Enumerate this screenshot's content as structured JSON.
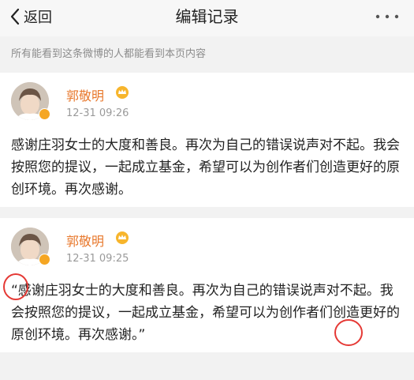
{
  "nav": {
    "back_label": "返回",
    "title": "编辑记录",
    "more_label": "···"
  },
  "notice": "所有能看到这条微博的人都能看到本页内容",
  "records": [
    {
      "user": "郭敬明",
      "time": "12-31 09:26",
      "content": "感谢庄羽女士的大度和善良。再次为自己的错误说声对不起。我会按照您的提议，一起成立基金，希望可以为创作者们创造更好的原创环境。再次感谢。"
    },
    {
      "user": "郭敬明",
      "time": "12-31 09:25",
      "content": "“感谢庄羽女士的大度和善良。再次为自己的错误说声对不起。我会按照您的提议，一起成立基金，希望可以为创作者们创造更好的原创环境。再次感谢。”"
    }
  ],
  "colors": {
    "username": "#e8782c",
    "annotation": "#e53935",
    "badge": "#f5a623"
  }
}
